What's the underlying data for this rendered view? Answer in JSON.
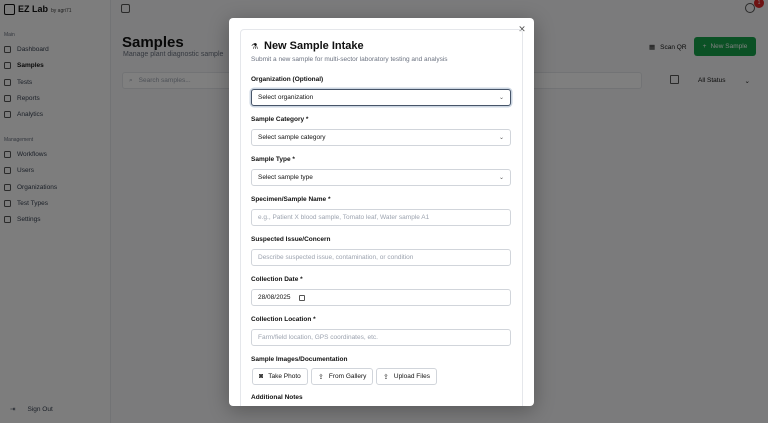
{
  "app": {
    "name": "EZ Lab",
    "sub": "by agri71"
  },
  "sidebar": {
    "main_label": "Main",
    "mgmt_label": "Management",
    "main_items": [
      {
        "label": "Dashboard"
      },
      {
        "label": "Samples"
      },
      {
        "label": "Tests"
      },
      {
        "label": "Reports"
      },
      {
        "label": "Analytics"
      }
    ],
    "mgmt_items": [
      {
        "label": "Workflows"
      },
      {
        "label": "Users"
      },
      {
        "label": "Organizations"
      },
      {
        "label": "Test Types"
      },
      {
        "label": "Settings"
      }
    ],
    "signout": "Sign Out"
  },
  "header": {
    "notification_count": "1"
  },
  "page": {
    "title": "Samples",
    "subtitle": "Manage plant diagnostic sample",
    "scan_button": "Scan QR",
    "new_button": "New Sample",
    "search_placeholder": "Search samples...",
    "status_filter": "All Status"
  },
  "modal": {
    "title": "New Sample Intake",
    "subtitle": "Submit a new sample for multi-sector laboratory testing and analysis",
    "organization": {
      "label": "Organization (Optional)",
      "value": "Select organization"
    },
    "category": {
      "label": "Sample Category *",
      "value": "Select sample category"
    },
    "type": {
      "label": "Sample Type *",
      "value": "Select sample type"
    },
    "specimen": {
      "label": "Specimen/Sample Name *",
      "placeholder": "e.g., Patient X blood sample, Tomato leaf, Water sample A1"
    },
    "issue": {
      "label": "Suspected Issue/Concern",
      "placeholder": "Describe suspected issue, contamination, or condition"
    },
    "date": {
      "label": "Collection Date *",
      "value": "28/08/2025"
    },
    "location": {
      "label": "Collection Location *",
      "placeholder": "Farm/field location, GPS coordinates, etc."
    },
    "images": {
      "label": "Sample Images/Documentation",
      "take_photo": "Take Photo",
      "from_gallery": "From Gallery",
      "upload_files": "Upload Files"
    },
    "notes_label": "Additional Notes"
  },
  "icons": {
    "dashboard": "dashboard-icon",
    "samples": "flask-icon",
    "tests": "test-tube-icon",
    "reports": "file-icon",
    "analytics": "chart-icon",
    "workflows": "workflow-icon",
    "users": "users-icon",
    "organizations": "building-icon",
    "test_types": "tag-icon",
    "settings": "gear-icon",
    "close": "close-icon",
    "camera": "camera-icon",
    "gallery": "upload-icon",
    "calendar": "calendar-icon"
  },
  "colors": {
    "primary": "#16a34a",
    "badge": "#dc2626"
  }
}
